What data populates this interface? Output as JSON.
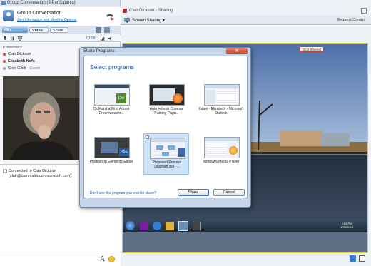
{
  "left_window": {
    "title": "Group Conversation (3 Participants)",
    "conversation_title": "Group Conversation",
    "info_link": "Join Information and Meeting Options",
    "modality": {
      "im_label": "IM",
      "video_label": "Video",
      "share_label": "Share"
    },
    "call_time": "03:09",
    "presenters_label": "Presenters",
    "participants": [
      {
        "name": "Clair Dickson",
        "status_color": "#d23c2c"
      },
      {
        "name": "Elizabeth Nofs",
        "status_color": "#d23c2c"
      },
      {
        "name": "Glen Glick",
        "role": "Guest",
        "status_color": "#9aa3ad"
      }
    ],
    "chat": {
      "line1": "Connected to Clair Dickson",
      "line2": "(clair@commalms.onmicrosoft.com)."
    },
    "font_icon_label": "A"
  },
  "right_window": {
    "title": "Clair Dickson - Sharing",
    "screen_sharing_label": "Screen Sharing",
    "request_control": "Request Control",
    "stop_sharing": "Stop Sharing",
    "taskbar_time": "2:04 PM",
    "taskbar_date": "1/30/2013"
  },
  "dialog": {
    "title": "Share Programs",
    "heading": "Select programs",
    "programs": [
      {
        "label": "CicMarshalWnd Adobe Dreamweaver...",
        "icon": "dreamweaver-thumbnail"
      },
      {
        "label": "Auto refresh Comma Training Page...",
        "icon": "firefox-thumbnail"
      },
      {
        "label": "Inbox - Elizabeth - Microsoft Outlook",
        "icon": "outlook-thumbnail"
      },
      {
        "label": "Photoshop Elements Editor",
        "icon": "photoshop-thumbnail"
      },
      {
        "label": "Proposed Process Diagram.vsd -...",
        "icon": "visio-thumbnail"
      },
      {
        "label": "Windows Media Player",
        "icon": "media-player-thumbnail"
      }
    ],
    "dont_see_link": "Don't see the program you want to share?",
    "share_button": "Share",
    "cancel_button": "Cancel"
  },
  "colors": {
    "accent_blue": "#1b52a8",
    "link_blue": "#1a62c8",
    "presence_busy": "#d23c2c",
    "selection": "#cde3f8"
  }
}
